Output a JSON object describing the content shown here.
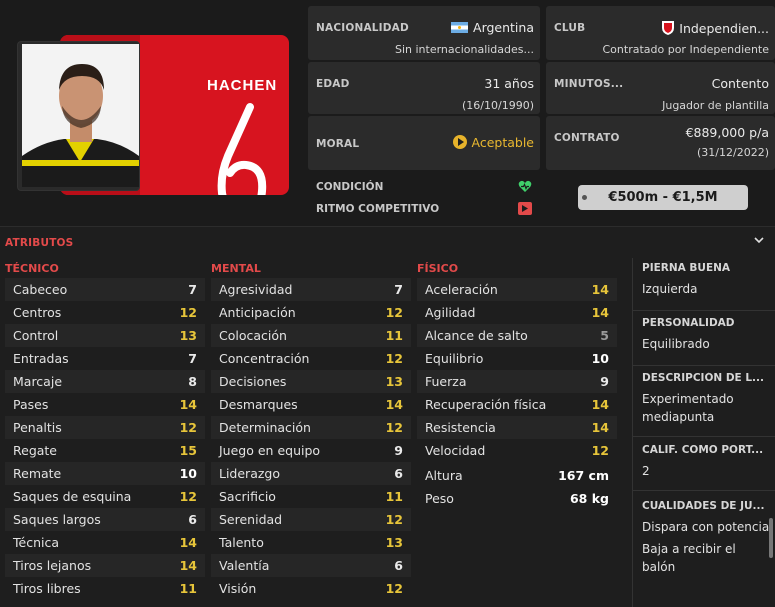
{
  "player": {
    "kit_name": "HACHEN",
    "kit_number": "6"
  },
  "info": {
    "nationality": {
      "label": "NACIONALIDAD",
      "value": "Argentina",
      "sub": "Sin internacionalidades..."
    },
    "club": {
      "label": "CLUB",
      "value": "Independien...",
      "sub": "Contratado por Independiente"
    },
    "age": {
      "label": "EDAD",
      "value": "31 años",
      "sub": "(16/10/1990)"
    },
    "minutes": {
      "label": "MINUTOS...",
      "value": "Contento",
      "sub": "Jugador de plantilla"
    },
    "morale": {
      "label": "MORAL",
      "value": "Aceptable"
    },
    "contract": {
      "label": "CONTRATO",
      "value": "€889,000 p/a",
      "sub": "(31/12/2022)"
    },
    "condition": {
      "label": "CONDICIÓN"
    },
    "match_fitness": {
      "label": "RITMO COMPETITIVO"
    },
    "value_range": "€500m - €1,5M"
  },
  "attributes": {
    "title": "ATRIBUTOS",
    "technical": {
      "title": "TÉCNICO",
      "rows": [
        {
          "name": "Cabeceo",
          "value": "7"
        },
        {
          "name": "Centros",
          "value": "12"
        },
        {
          "name": "Control",
          "value": "13"
        },
        {
          "name": "Entradas",
          "value": "7"
        },
        {
          "name": "Marcaje",
          "value": "8"
        },
        {
          "name": "Pases",
          "value": "14"
        },
        {
          "name": "Penaltis",
          "value": "12"
        },
        {
          "name": "Regate",
          "value": "15"
        },
        {
          "name": "Remate",
          "value": "10"
        },
        {
          "name": "Saques de esquina",
          "value": "12"
        },
        {
          "name": "Saques largos",
          "value": "6"
        },
        {
          "name": "Técnica",
          "value": "14"
        },
        {
          "name": "Tiros lejanos",
          "value": "14"
        },
        {
          "name": "Tiros libres",
          "value": "11"
        }
      ]
    },
    "mental": {
      "title": "MENTAL",
      "rows": [
        {
          "name": "Agresividad",
          "value": "7"
        },
        {
          "name": "Anticipación",
          "value": "12"
        },
        {
          "name": "Colocación",
          "value": "11"
        },
        {
          "name": "Concentración",
          "value": "12"
        },
        {
          "name": "Decisiones",
          "value": "13"
        },
        {
          "name": "Desmarques",
          "value": "14"
        },
        {
          "name": "Determinación",
          "value": "12"
        },
        {
          "name": "Juego en equipo",
          "value": "9"
        },
        {
          "name": "Liderazgo",
          "value": "6"
        },
        {
          "name": "Sacrificio",
          "value": "11"
        },
        {
          "name": "Serenidad",
          "value": "12"
        },
        {
          "name": "Talento",
          "value": "13"
        },
        {
          "name": "Valentía",
          "value": "6"
        },
        {
          "name": "Visión",
          "value": "12"
        }
      ]
    },
    "physical": {
      "title": "FÍSICO",
      "rows": [
        {
          "name": "Aceleración",
          "value": "14"
        },
        {
          "name": "Agilidad",
          "value": "14"
        },
        {
          "name": "Alcance de salto",
          "value": "5"
        },
        {
          "name": "Equilibrio",
          "value": "10"
        },
        {
          "name": "Fuerza",
          "value": "9"
        },
        {
          "name": "Recuperación física",
          "value": "14"
        },
        {
          "name": "Resistencia",
          "value": "14"
        },
        {
          "name": "Velocidad",
          "value": "12"
        }
      ],
      "height": {
        "name": "Altura",
        "value": "167 cm"
      },
      "weight": {
        "name": "Peso",
        "value": "68 kg"
      }
    }
  },
  "side": {
    "foot": {
      "label": "PIERNA BUENA",
      "value": "Izquierda"
    },
    "personality": {
      "label": "PERSONALIDAD",
      "value": "Equilibrado"
    },
    "description": {
      "label": "DESCRIPCIÓN DE L...",
      "value": "Experimentado mediapunta"
    },
    "gk_rating": {
      "label": "CALIF. COMO PORT...",
      "value": "2"
    },
    "traits": {
      "label": "CUALIDADES DE JU...",
      "items": [
        "Dispara con potencia",
        "Baja a recibir el balón"
      ]
    }
  },
  "colors": {
    "accent_red": "#e34a4a",
    "highlight_yellow": "#e7c53a",
    "kit_red": "#d7141f"
  }
}
